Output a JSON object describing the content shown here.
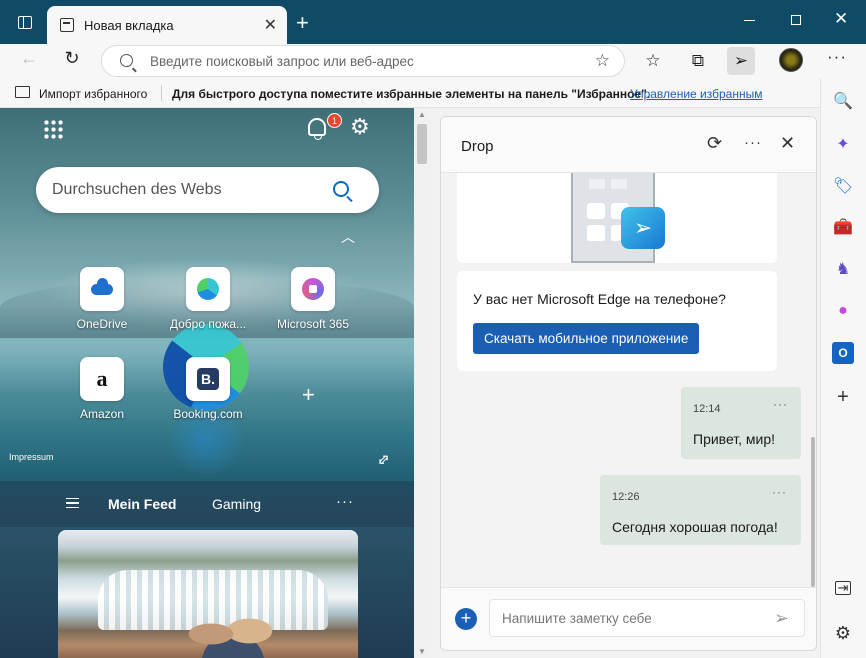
{
  "titlebar": {
    "tab_title": "Новая вкладка",
    "tab_close": "✕",
    "new_tab": "+",
    "window_close": "✕"
  },
  "addressbar": {
    "back": "←",
    "refresh": "↻",
    "placeholder": "Введите поисковый запрос или веб-адрес",
    "favorite": "☆",
    "tools": {
      "favorites": "☆",
      "collections": "⧉",
      "drop": "➢",
      "more": "···"
    }
  },
  "favorites_bar": {
    "import_label": "Импорт избранного",
    "hint": "Для быстрого доступа поместите избранные элементы на панель \"Избранное\".",
    "manage_link": "Управление избранным"
  },
  "ntp": {
    "notification_count": "1",
    "settings": "⚙",
    "search_placeholder": "Durchsuchen des Webs",
    "collapse": "︿",
    "tiles": [
      {
        "label": "OneDrive"
      },
      {
        "label": "Добро пожа..."
      },
      {
        "label": "Microsoft 365"
      },
      {
        "label": "Amazon",
        "glyph": "a"
      },
      {
        "label": "Booking.com",
        "glyph": "B."
      }
    ],
    "add_tile": "+",
    "impressum": "Impressum",
    "expand": "⇕",
    "feed": {
      "active_tab": "Mein Feed",
      "tab_gaming": "Gaming",
      "more": "···"
    }
  },
  "drop": {
    "title": "Drop",
    "sync": "⟳",
    "more": "···",
    "close": "✕",
    "promo_badge": "➢",
    "promo_text": "У вас нет Microsoft Edge на телефоне?",
    "promo_button": "Скачать мобильное приложение",
    "messages": [
      {
        "time": "12:14",
        "text": "Привет, мир!",
        "more": "···"
      },
      {
        "time": "12:26",
        "text": "Сегодня хорошая погода!",
        "more": "···"
      }
    ],
    "composer_add": "+",
    "composer_placeholder": "Напишите заметку себе",
    "composer_send": "➢"
  },
  "sidebar": {
    "search": "🔍",
    "copilot": "✦",
    "shopping": "🏷",
    "tools": "🧰",
    "games": "♞",
    "m365": "●",
    "outlook": "O",
    "add": "+",
    "hide": "⇥",
    "settings": "⚙"
  }
}
